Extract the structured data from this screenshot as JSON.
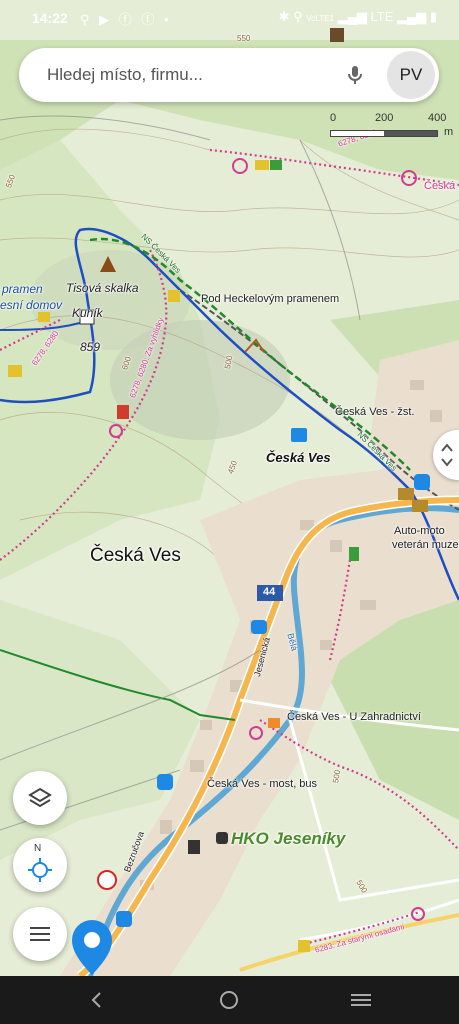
{
  "status_bar": {
    "time": "14:22",
    "network": "LTE",
    "volte": "VoLTE1"
  },
  "search": {
    "placeholder": "Hledej místo, firmu...",
    "avatar_initials": "PV"
  },
  "scale": {
    "ticks": [
      "0",
      "200",
      "400"
    ],
    "unit": "m"
  },
  "map_labels": {
    "contour_550_top": "550",
    "contour_500_mid": "500",
    "contour_450": "450",
    "contour_550_left": "550",
    "contour_600": "600",
    "contour_500_bottom": "500",
    "contour_500_right": "500",
    "pramen": "pramen",
    "lesni_domov": "esní domov",
    "tisova_skalka": "Tisová skalka",
    "kunik": "Kuník",
    "elevation_859": "859",
    "pod_heckelovym": "Pod Heckelovým pramenem",
    "ceska_ves_zst": "Česká Ves - žst.",
    "ceska_ves_town": "Česká Ves",
    "ceska_ves_big": "Česká Ves",
    "ceska_right": "Česká",
    "ns_ceska_ves_1": "NS Česká Ves",
    "ns_ceska_ves_2": "NS Česká Ves",
    "route_6278": "6278, 6280",
    "route_6278b": "6278, 6280",
    "route_zavyhlidky": "6278, 6280: Za vyhlídky",
    "auto_moto": "Auto-moto",
    "veteran": "veterán muzeum",
    "road_44": "44",
    "jesenicka": "Jesenická",
    "bela": "Bělá",
    "u_zahradnictvi": "Česká Ves - U Zahradnictví",
    "most_bus": "Česká Ves - most, bus",
    "hko_jeseniky": "HKO Jeseníky",
    "bezrucova": "Bezručova",
    "za_starymi": "6283: Za starými osadami"
  },
  "controls": {
    "layers_icon": "layers-icon",
    "compass_letter": "N",
    "menu_icon": "menu-icon"
  },
  "colors": {
    "road": "#f5b64e",
    "river": "#5fa8d3",
    "trail_blue": "#1e4fc2",
    "trail_green": "#1f8a2a",
    "trail_pink": "#d23b8f",
    "rail": "#555555"
  }
}
